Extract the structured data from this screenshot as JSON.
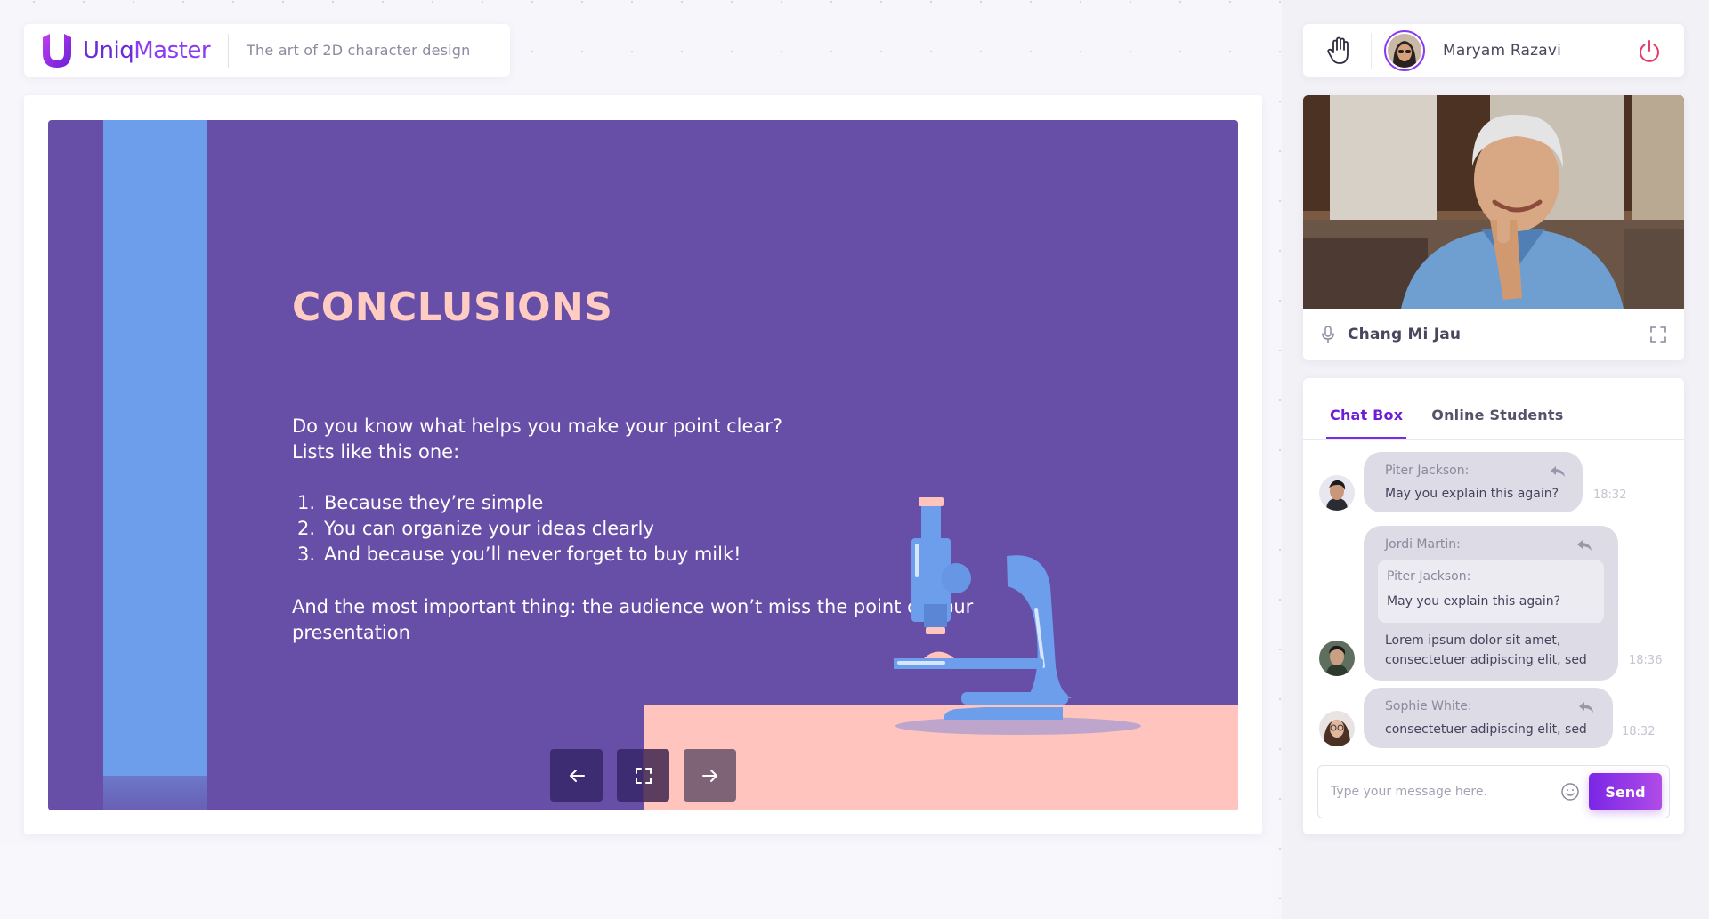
{
  "header": {
    "brand_bold": "Uniq",
    "brand_light": "Master",
    "course_title": "The art of  2D character design"
  },
  "slide": {
    "heading": "CONCLUSIONS",
    "intro_line1": "Do you know what helps you make your point clear?",
    "intro_line2": "Lists like this one:",
    "list": [
      {
        "num": "1.",
        "text": "Because they’re simple"
      },
      {
        "num": "2.",
        "text": "You can organize your ideas clearly"
      },
      {
        "num": "3.",
        "text": "And because you’ll never forget to buy milk!"
      }
    ],
    "outro_line1": "And the most important thing: the audience won’t miss the point of your",
    "outro_line2": "presentation"
  },
  "slide_controls": {
    "prev_icon": "arrow-left-icon",
    "fullscreen_icon": "fullscreen-icon",
    "next_icon": "arrow-right-icon"
  },
  "user": {
    "name": "Maryam Razavi",
    "raise_hand_icon": "hand-icon",
    "power_icon": "power-icon"
  },
  "video": {
    "speaker_name": "Chang Mi Jau",
    "mic_icon": "microphone-icon",
    "expand_icon": "expand-icon"
  },
  "chat": {
    "tabs": [
      {
        "label": "Chat Box",
        "active": true
      },
      {
        "label": "Online Students",
        "active": false
      }
    ],
    "messages": [
      {
        "author": "Piter Jackson:",
        "text": "May you explain this again?",
        "time": "18:32"
      },
      {
        "author": "Jordi Martin:",
        "quote_author": "Piter Jackson:",
        "quote_text": "May you explain this again?",
        "text_line1": "Lorem ipsum dolor sit amet,",
        "text_line2": "consectetuer adipiscing elit, sed",
        "time": "18:36"
      },
      {
        "author": "Sophie White:",
        "text": "consectetuer adipiscing elit, sed",
        "time": "18:32"
      }
    ],
    "input_placeholder": "Type your message here.",
    "send_label": "Send"
  },
  "colors": {
    "accent": "#6a1fd6",
    "slide_bg": "#674ea7",
    "slide_blue": "#6d9eeb",
    "slide_pink": "#ffc4bd",
    "power_red": "#e53d6b"
  }
}
